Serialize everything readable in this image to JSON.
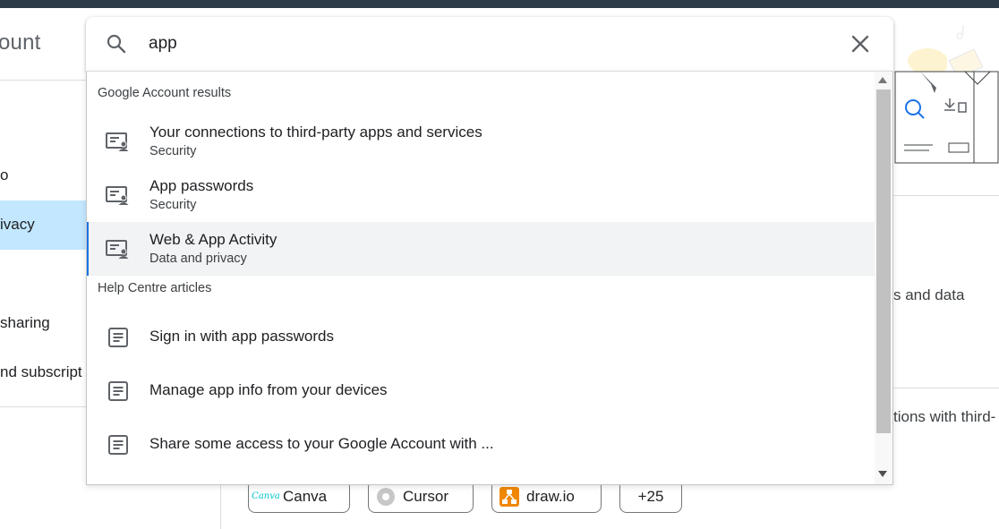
{
  "header": {
    "title_fragment": "ount"
  },
  "sidebar": {
    "items": [
      {
        "label": "o"
      },
      {
        "label": "ivacy"
      },
      {
        "label": "sharing"
      },
      {
        "label": "nd subscript"
      }
    ]
  },
  "right_content": {
    "text1": "s and data",
    "text2": "tions with third-"
  },
  "chips": [
    {
      "label": "Canva",
      "logo_text": "Canva"
    },
    {
      "label": "Cursor"
    },
    {
      "label": "draw.io"
    },
    {
      "label": "+25"
    }
  ],
  "search": {
    "value": "app",
    "icon": "search-icon",
    "clear_icon": "close-icon"
  },
  "dropdown": {
    "account_header": "Google Account results",
    "results": [
      {
        "title": "Your connections to third-party apps and services",
        "subtitle": "Security"
      },
      {
        "title": "App passwords",
        "subtitle": "Security"
      },
      {
        "title": "Web & App Activity",
        "subtitle": "Data and privacy"
      }
    ],
    "help_header": "Help Centre articles",
    "articles": [
      {
        "title": "Sign in with app passwords"
      },
      {
        "title": "Manage app info from your devices"
      },
      {
        "title": "Share some access to your Google Account with ..."
      }
    ]
  },
  "colors": {
    "topbar": "#2d3a47",
    "active_nav": "#c2e7ff",
    "highlight_accent": "#1a73e8",
    "drawio_orange": "#f08705"
  }
}
